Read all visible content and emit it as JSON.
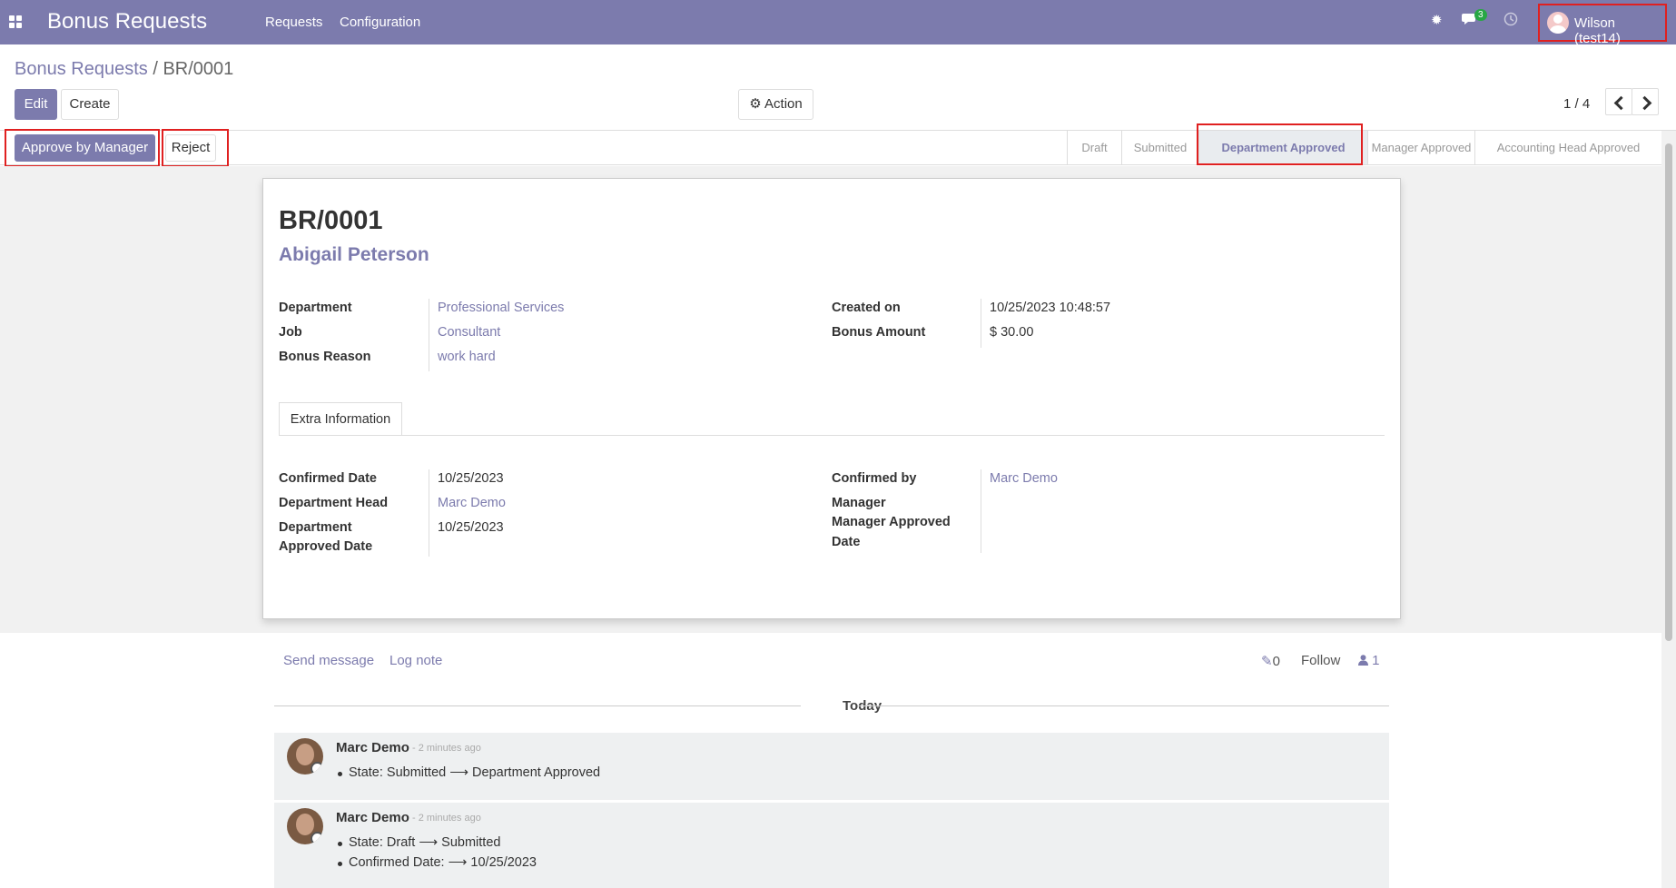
{
  "nav": {
    "app_title": "Bonus Requests",
    "menu": [
      "Requests",
      "Configuration"
    ],
    "messages_count": "3",
    "user": "Wilson (test14)"
  },
  "breadcrumb": {
    "parent": "Bonus Requests",
    "separator": "/",
    "current": "BR/0001"
  },
  "buttons": {
    "edit": "Edit",
    "create": "Create",
    "action": "Action",
    "approve": "Approve by Manager",
    "reject": "Reject"
  },
  "pager": "1 / 4",
  "stages": [
    "Draft",
    "Submitted",
    "Department Approved",
    "Manager Approved",
    "Accounting Head Approved"
  ],
  "active_stage": "Department Approved",
  "record": {
    "name": "BR/0001",
    "employee": "Abigail Peterson",
    "department_label": "Department",
    "department": "Professional Services",
    "job_label": "Job",
    "job": "Consultant",
    "reason_label": "Bonus Reason",
    "reason": "work hard",
    "created_label": "Created on",
    "created": "10/25/2023 10:48:57",
    "amount_label": "Bonus Amount",
    "amount": "$ 30.00"
  },
  "tab": "Extra Information",
  "extra": {
    "confirmed_date_label": "Confirmed Date",
    "confirmed_date": "10/25/2023",
    "dept_head_label": "Department Head",
    "dept_head": "Marc Demo",
    "dept_approved_label_1": "Department",
    "dept_approved_label_2": "Approved Date",
    "dept_approved": "10/25/2023",
    "confirmed_by_label": "Confirmed by",
    "confirmed_by": "Marc Demo",
    "manager_label": "Manager",
    "mgr_approved_label_1": "Manager Approved",
    "mgr_approved_label_2": "Date"
  },
  "chatter": {
    "send": "Send message",
    "log": "Log note",
    "attachments": "0",
    "follow": "Follow",
    "followers": "1",
    "today": "Today",
    "messages": [
      {
        "author": "Marc Demo",
        "time": "- 2 minutes ago",
        "lines": [
          "State: Submitted ⟶ Department Approved"
        ]
      },
      {
        "author": "Marc Demo",
        "time": "- 2 minutes ago",
        "lines": [
          "State: Draft ⟶ Submitted",
          "Confirmed Date: ⟶ 10/25/2023"
        ]
      }
    ]
  }
}
